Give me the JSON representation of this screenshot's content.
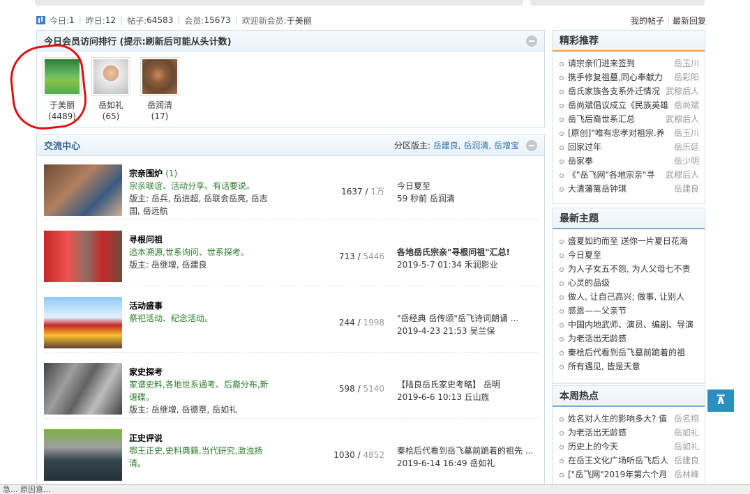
{
  "stats": {
    "today_label": "今日:",
    "today": "1",
    "yesterday_label": "昨日:",
    "yesterday": "12",
    "posts_label": "帖子:",
    "posts": "64583",
    "members_label": "会员:",
    "members": "15673",
    "welcome_label": "欢迎新会员:",
    "welcome_name": "于美丽",
    "my_posts": "我的帖子",
    "latest_reply": "最新回复"
  },
  "rank": {
    "title": "今日会员访问排行 (提示:刷新后可能从头计数)",
    "members": [
      {
        "name": "于美丽",
        "count": "(4489)"
      },
      {
        "name": "岳如礼",
        "count": "(65)"
      },
      {
        "name": "岳润清",
        "count": "(17)"
      }
    ]
  },
  "forum": {
    "title": "交流中心",
    "mods_label": "分区版主:",
    "mods": "岳建良, 岳润清, 岳增宝",
    "rows": [
      {
        "title": "宗亲围炉",
        "new": "(1)",
        "desc": "宗亲联谊、活动分享、有话要说。",
        "mods": "版主: 岳兵, 岳进超, 岳联会岳亮, 岳志国, 岳远航",
        "threads": "1637",
        "posts": "1万",
        "last_title": "今日夏至",
        "last_meta": "59 秒前 岳润清"
      },
      {
        "title": "寻根问祖",
        "new": "",
        "desc": "追本溯源,世系询问、世系探考。",
        "mods": "版主: 岳继增, 岳建良",
        "threads": "713",
        "posts": "5446",
        "last_title": "各地岳氏宗亲\"寻根问祖\"汇总!",
        "last_meta": "2019-5-7 01:34 禾润影业"
      },
      {
        "title": "活动盛事",
        "new": "",
        "desc": "祭祀活动、纪念活动。",
        "mods": "",
        "threads": "244",
        "posts": "1998",
        "last_title": "\"岳经典 岳传颂\"岳飞诗词朗诵 ...",
        "last_meta": "2019-4-23 21:53 吴兰保"
      },
      {
        "title": "家史探考",
        "new": "",
        "desc": "家谱史料,各地世系通考、后裔分布,新谱碟。",
        "mods": "版主: 岳继增, 岳德章, 岳如礼",
        "threads": "598",
        "posts": "5140",
        "last_title": "【陆良岳氏家史考略】 岳明",
        "last_meta": "2019-6-6 10:13 丘山旌"
      },
      {
        "title": "正史评说",
        "new": "",
        "desc": "鄂王正史,史料典籍,当代研究,激浊扬清。",
        "mods": "",
        "threads": "1030",
        "posts": "4852",
        "last_title": "秦桧后代看到岳飞墓前跪着的祖先 ...",
        "last_meta": "2019-6-14 16:49 岳如礼"
      }
    ]
  },
  "featured": {
    "title": "精彩推荐",
    "items": [
      {
        "t": "请宗亲们进来签到",
        "a": "岳玉川"
      },
      {
        "t": "携手修复祖墓,同心奉献力",
        "a": "岳彩阳"
      },
      {
        "t": "岳氏家族各支系外迁情况",
        "a": "武穆后人"
      },
      {
        "t": "岳尚斌倡议成立《民族英雄",
        "a": "岳尚斌"
      },
      {
        "t": "岳飞后裔世系汇总",
        "a": "武穆后人"
      },
      {
        "t": "[原创]\"唯有忠孝对祖宗.养",
        "a": "岳玉川"
      },
      {
        "t": "回家过年",
        "a": "岳乐廷"
      },
      {
        "t": "岳家拳",
        "a": "岳少明"
      },
      {
        "t": "《\"岳飞网\"各地宗亲\"寻",
        "a": "武穆后人"
      },
      {
        "t": "大清藩篱岳钟琪",
        "a": "岳建良"
      }
    ]
  },
  "latest": {
    "title": "最新主题",
    "items": [
      {
        "t": "盛夏如约而至 送你一片夏日花海"
      },
      {
        "t": "今日夏至"
      },
      {
        "t": "为人子女五不怨, 为人父母七不责"
      },
      {
        "t": "心灵的品级"
      },
      {
        "t": "做人, 让自己高兴; 做事, 让别人"
      },
      {
        "t": "感恩——父亲节"
      },
      {
        "t": "中国内地武师、演员、编剧、导演"
      },
      {
        "t": "为老活出无龄感"
      },
      {
        "t": "秦桧后代看到岳飞墓前跪着的祖"
      },
      {
        "t": "所有遇见, 皆是天意"
      }
    ]
  },
  "hot": {
    "title": "本周热点",
    "items": [
      {
        "t": "姓名对人生的影响多大? 值",
        "a": "岳名翔"
      },
      {
        "t": "为老活出无龄感",
        "a": "岳如礼"
      },
      {
        "t": "历史上的今天",
        "a": "岳如礼"
      },
      {
        "t": "在岳王文化广场听岳飞后人",
        "a": "岳建良"
      },
      {
        "t": "[\"岳飞网\"2019年第六个月",
        "a": "岳林峰"
      }
    ]
  },
  "status": "急... 原因意..."
}
